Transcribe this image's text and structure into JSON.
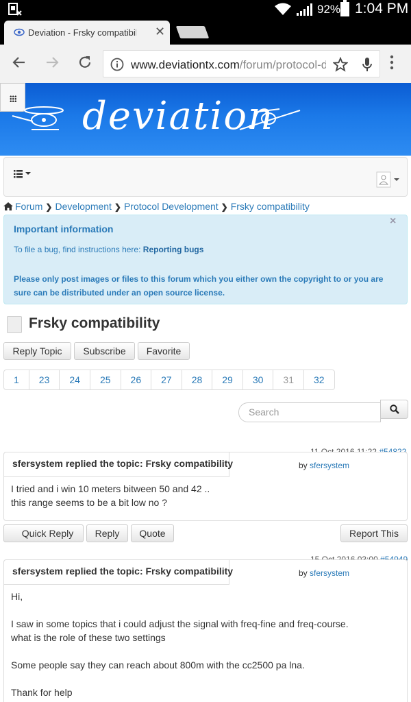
{
  "status": {
    "battery": "92%",
    "time": "1:04 PM"
  },
  "tab": {
    "title": "Deviation - Frsky compatibility"
  },
  "address": {
    "domain": "www.deviationtx.com",
    "path": "/forum/protocol-de"
  },
  "banner": {
    "logo_text": "deviation"
  },
  "breadcrumb": [
    "Forum",
    "Development",
    "Protocol Development",
    "Frsky compatibility"
  ],
  "alert": {
    "title": "Important information",
    "line1_text": "To file a bug, find instructions here: ",
    "line1_link": "Reporting bugs",
    "line2": "Please only post images or files to this forum which you either own the copyright to or you are sure can be distributed under an open source license."
  },
  "topic": {
    "title": "Frsky compatibility",
    "buttons": {
      "reply": "Reply Topic",
      "subscribe": "Subscribe",
      "favorite": "Favorite"
    }
  },
  "pagination": [
    "1",
    "23",
    "24",
    "25",
    "26",
    "27",
    "28",
    "29",
    "30",
    "31",
    "32"
  ],
  "search": {
    "placeholder": "Search"
  },
  "posts": [
    {
      "date": "11 Oct 2016 11:22",
      "id": "#54822",
      "heading": "sfersystem replied the topic: Frsky compatibility",
      "by": "by",
      "user": "sfersystem",
      "lines": [
        "I tried and i win 10 meters bitween 50 and 42 ..",
        "this range seems to be a bit low no ?"
      ],
      "actions": {
        "quick_reply": "Quick Reply",
        "reply": "Reply",
        "quote": "Quote",
        "report": "Report This"
      }
    },
    {
      "date": "15 Oct 2016 03:00",
      "id": "#54949",
      "heading": "sfersystem replied the topic: Frsky compatibility",
      "by": "by",
      "user": "sfersystem",
      "lines": [
        "Hi,",
        "",
        "I saw in some topics that i could adjust the signal with freq-fine and freq-course.",
        "what is the role of these two settings",
        "",
        "Some people say they can reach about 800m with the cc2500 pa lna.",
        "",
        "Thank for help"
      ]
    }
  ]
}
